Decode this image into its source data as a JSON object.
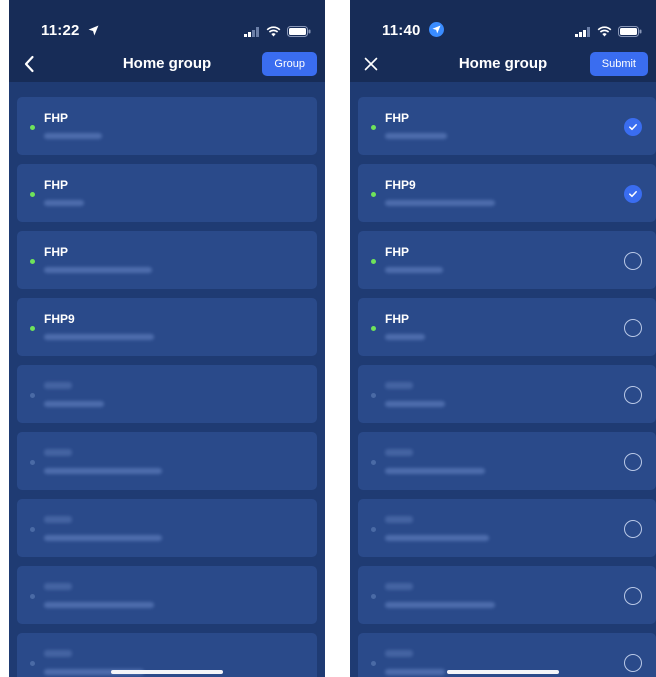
{
  "left": {
    "time": "11:22",
    "title": "Home group",
    "action_label": "Group",
    "items": [
      {
        "name": "FHP",
        "online": true,
        "sub_w": 58
      },
      {
        "name": "FHP",
        "online": true,
        "sub_w": 40
      },
      {
        "name": "FHP",
        "online": true,
        "sub_w": 108
      },
      {
        "name": "FHP9",
        "online": true,
        "sub_w": 110
      },
      {
        "name": "",
        "online": false,
        "sub_w": 60
      },
      {
        "name": "",
        "online": false,
        "sub_w": 118
      },
      {
        "name": "",
        "online": false,
        "sub_w": 118
      },
      {
        "name": "",
        "online": false,
        "sub_w": 110
      },
      {
        "name": "",
        "online": false,
        "sub_w": 100
      }
    ]
  },
  "right": {
    "time": "11:40",
    "title": "Home group",
    "action_label": "Submit",
    "items": [
      {
        "name": "FHP",
        "online": true,
        "checked": true
      },
      {
        "name": "FHP9",
        "online": true,
        "checked": true
      },
      {
        "name": "FHP",
        "online": true,
        "checked": false
      },
      {
        "name": "FHP",
        "online": true,
        "checked": false
      },
      {
        "name": "",
        "online": false,
        "checked": false
      },
      {
        "name": "",
        "online": false,
        "checked": false
      },
      {
        "name": "",
        "online": false,
        "checked": false
      },
      {
        "name": "",
        "online": false,
        "checked": false
      },
      {
        "name": "",
        "online": false,
        "checked": false
      }
    ]
  },
  "icons": {
    "back": "chevron-left-icon",
    "close": "close-icon",
    "location": "location-arrow-icon",
    "signal": "signal-icon",
    "wifi": "wifi-icon",
    "battery": "battery-icon",
    "checked": "check-circle-icon",
    "unchecked": "empty-radio-icon"
  },
  "colors": {
    "background": "#1f3b73",
    "header": "#172c57",
    "card": "#2a4a8a",
    "accent": "#3a6df0",
    "online": "#6fe35a"
  }
}
